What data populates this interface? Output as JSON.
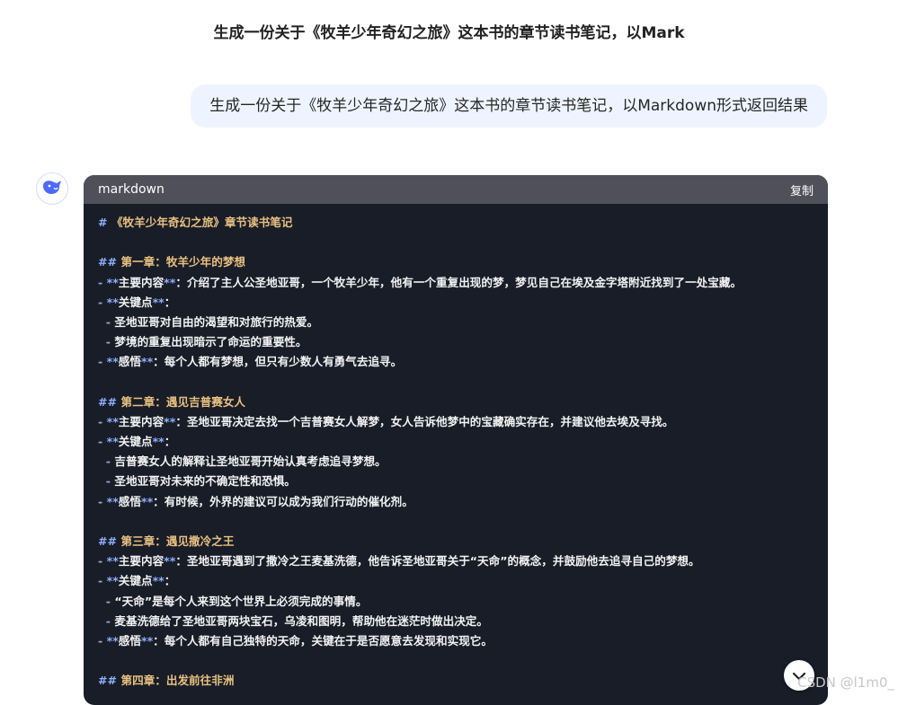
{
  "title": "生成一份关于《牧羊少年奇幻之旅》这本书的章节读书笔记，以Mark",
  "user_message": "生成一份关于《牧羊少年奇幻之旅》这本书的章节读书笔记，以Markdown形式返回结果",
  "code": {
    "language": "markdown",
    "copy_label": "复制",
    "lines": {
      "l01_mark": "#",
      "l01_text": " 《牧羊少年奇幻之旅》章节读书笔记",
      "l03_mark": "##",
      "l03_text": " 第一章：牧羊少年的梦想",
      "l04_a": "- ",
      "l04_b": "**",
      "l04_c": "主要内容",
      "l04_d": "**",
      "l04_e": "：介绍了主人公圣地亚哥，一个牧羊少年，他有一个重复出现的梦，梦见自己在埃及金字塔附近找到了一处宝藏。",
      "l05_a": "- ",
      "l05_b": "**",
      "l05_c": "关键点",
      "l05_d": "**",
      "l05_e": "：",
      "l06_a": "  - ",
      "l06_e": "圣地亚哥对自由的渴望和对旅行的热爱。",
      "l07_a": "  - ",
      "l07_e": "梦境的重复出现暗示了命运的重要性。",
      "l08_a": "- ",
      "l08_b": "**",
      "l08_c": "感悟",
      "l08_d": "**",
      "l08_e": "：每个人都有梦想，但只有少数人有勇气去追寻。",
      "l10_mark": "##",
      "l10_text": " 第二章：遇见吉普赛女人",
      "l11_a": "- ",
      "l11_b": "**",
      "l11_c": "主要内容",
      "l11_d": "**",
      "l11_e": "：圣地亚哥决定去找一个吉普赛女人解梦，女人告诉他梦中的宝藏确实存在，并建议他去埃及寻找。",
      "l12_a": "- ",
      "l12_b": "**",
      "l12_c": "关键点",
      "l12_d": "**",
      "l12_e": "：",
      "l13_a": "  - ",
      "l13_e": "吉普赛女人的解释让圣地亚哥开始认真考虑追寻梦想。",
      "l14_a": "  - ",
      "l14_e": "圣地亚哥对未来的不确定性和恐惧。",
      "l15_a": "- ",
      "l15_b": "**",
      "l15_c": "感悟",
      "l15_d": "**",
      "l15_e": "：有时候，外界的建议可以成为我们行动的催化剂。",
      "l17_mark": "##",
      "l17_text": " 第三章：遇见撒冷之王",
      "l18_a": "- ",
      "l18_b": "**",
      "l18_c": "主要内容",
      "l18_d": "**",
      "l18_e": "：圣地亚哥遇到了撒冷之王麦基洗德，他告诉圣地亚哥关于“天命”的概念，并鼓励他去追寻自己的梦想。",
      "l19_a": "- ",
      "l19_b": "**",
      "l19_c": "关键点",
      "l19_d": "**",
      "l19_e": "：",
      "l20_a": "  - ",
      "l20_e": "“天命”是每个人来到这个世界上必须完成的事情。",
      "l21_a": "  - ",
      "l21_e": "麦基洗德给了圣地亚哥两块宝石，乌凌和图明，帮助他在迷茫时做出决定。",
      "l22_a": "- ",
      "l22_b": "**",
      "l22_c": "感悟",
      "l22_d": "**",
      "l22_e": "：每个人都有自己独特的天命，关键在于是否愿意去发现和实现它。",
      "l24_mark": "##",
      "l24_text": " 第四章：出发前往非洲"
    }
  },
  "watermark": "CSDN @l1m0_",
  "icons": {
    "avatar": "deepseek-whale-icon",
    "scroll": "chevron-down-icon"
  },
  "colors": {
    "code_bg": "#181d28",
    "code_header_bg": "#50505a",
    "heading": "#e9c07f",
    "markup": "#8fb0ff",
    "user_bubble_bg": "#eef4ff"
  }
}
